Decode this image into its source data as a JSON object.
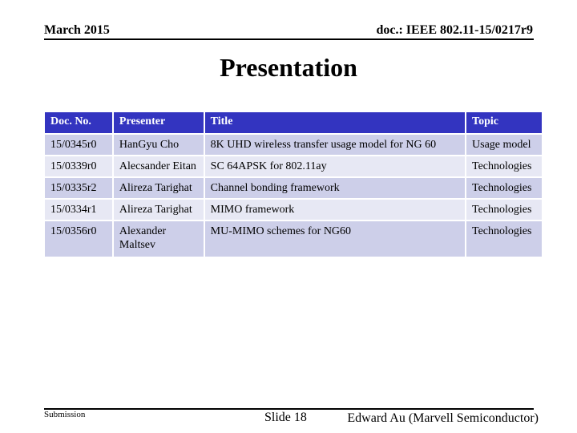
{
  "header": {
    "date": "March 2015",
    "doc_id": "doc.: IEEE 802.11-15/0217r9"
  },
  "slide_title": "Presentation",
  "table": {
    "columns": [
      "Doc. No.",
      "Presenter",
      "Title",
      "Topic"
    ],
    "rows": [
      {
        "doc_no": "15/0345r0",
        "presenter": "HanGyu Cho",
        "title": "8K UHD wireless transfer usage model for NG 60",
        "topic": "Usage model"
      },
      {
        "doc_no": "15/0339r0",
        "presenter": "Alecsander Eitan",
        "title": "SC 64APSK for 802.11ay",
        "topic": "Technologies"
      },
      {
        "doc_no": "15/0335r2",
        "presenter": "Alireza Tarighat",
        "title": "Channel bonding framework",
        "topic": "Technologies"
      },
      {
        "doc_no": "15/0334r1",
        "presenter": "Alireza Tarighat",
        "title": "MIMO framework",
        "topic": "Technologies"
      },
      {
        "doc_no": "15/0356r0",
        "presenter": "Alexander Maltsev",
        "title": "MU-MIMO schemes for NG60",
        "topic": "Technologies"
      }
    ]
  },
  "footer": {
    "left": "Submission",
    "center": "Slide 18",
    "right": "Edward Au (Marvell Semiconductor)"
  },
  "colors": {
    "header_row": "#3334c0",
    "row_odd": "#cdcfe9",
    "row_even": "#e7e8f4"
  }
}
